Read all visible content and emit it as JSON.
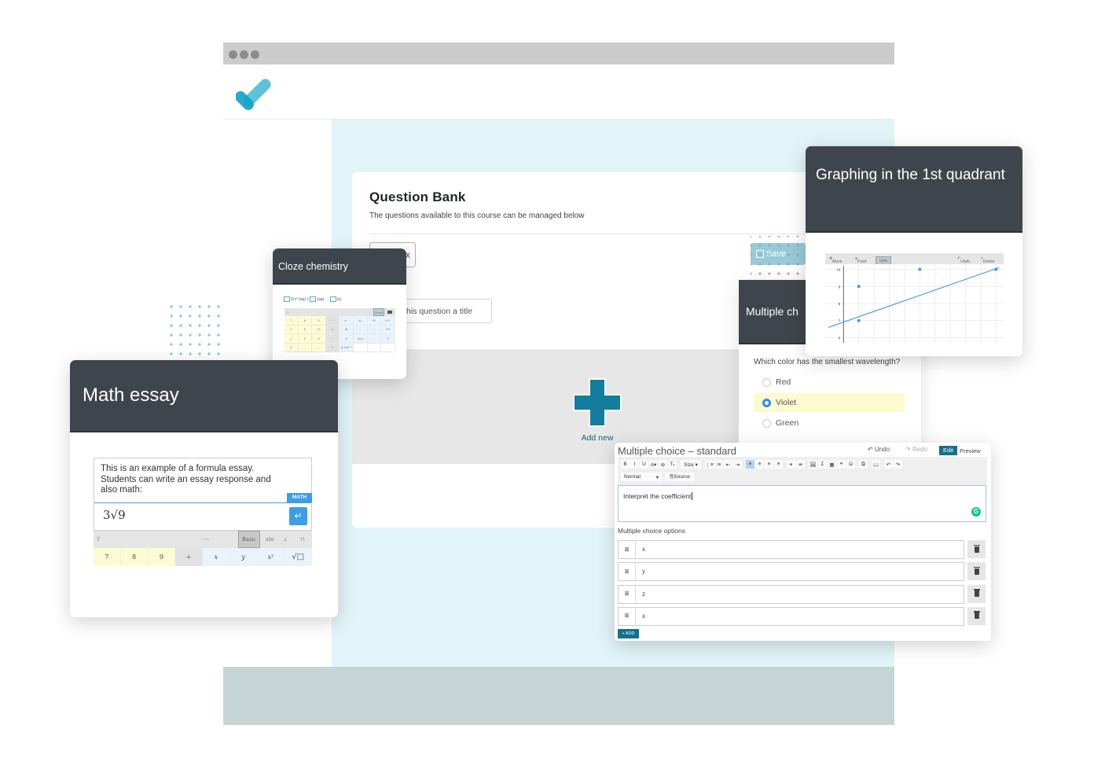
{
  "app": {
    "logo": "checkmark-logo",
    "window_dots": 3
  },
  "question_bank": {
    "title": "Question Bank",
    "subtitle": "The questions available to this course can be managed below",
    "partial_button_label": "x",
    "title_input_placeholder": "his question a title",
    "add_new_label": "Add new",
    "save_label": "Save"
  },
  "cloze_card": {
    "title": "Cloze chemistry",
    "equation": [
      "Zn²⁺(aq) +",
      "(aq) →",
      "(s)"
    ],
    "keypad_top_left": "?",
    "keypad_mode": "Chem",
    "keys": [
      "7",
      "8",
      "9",
      "÷",
      "e⁻",
      "Xₙ",
      "ᵃX",
      "Xₙᵐ",
      "4",
      "5",
      "6",
      "×",
      "⇌",
      "←",
      "→",
      "⟷",
      "1",
      "2",
      "3",
      "−",
      "½",
      "mol",
      "·",
      "δ",
      "0",
      ".",
      ",",
      "+",
      "g mol⁻¹",
      "",
      "",
      ""
    ]
  },
  "math_essay": {
    "title": "Math essay",
    "essay_text": "This is an example of a formula essay. Students can write an essay response and also math:",
    "math_tag": "MATH",
    "math_value": "3√9",
    "enter_icon": "↵",
    "keypad_top": {
      "help": "?",
      "handle": "····",
      "mode": "Basic",
      "sin": "sin",
      "angle": "∠",
      "cap": "∩"
    },
    "keys": [
      "7",
      "8",
      "9",
      "÷",
      "x",
      "y",
      "x²",
      "√□"
    ]
  },
  "multiple_choice": {
    "title": "Multiple ch",
    "question": "Which color has the smallest wavelength?",
    "options": [
      {
        "label": "Red",
        "selected": false
      },
      {
        "label": "Violet",
        "selected": true
      },
      {
        "label": "Green",
        "selected": false
      }
    ]
  },
  "graph_card": {
    "title": "Graphing in the 1st quadrant",
    "toolbar": {
      "move": "Move",
      "point": "Point",
      "line": "Line",
      "undo": "Undo",
      "delete": "Delete"
    },
    "y_ticks": [
      "10",
      "9",
      "8",
      "7",
      "6"
    ],
    "points": [
      [
        1,
        9
      ],
      [
        1,
        7
      ],
      [
        5,
        10
      ],
      [
        10,
        10
      ]
    ],
    "line": {
      "from": [
        -1,
        6.6
      ],
      "to": [
        10.2,
        10.1
      ]
    },
    "accent": "#3c9de8"
  },
  "editor": {
    "title": "Multiple choice – standard",
    "undo": "Undo",
    "redo": "Redo",
    "edit_tab": "Edit",
    "preview_tab": "Preview",
    "toolbar_row1": [
      "B",
      "I",
      "U",
      "A▾",
      "⊚",
      "Tₓ",
      "Size ▾",
      "⋮≡",
      "⁝≡",
      "⇤",
      "⇥",
      "≡",
      "≡",
      "≡",
      "≡",
      "⚭",
      "⚮",
      "🖼",
      "Σ",
      "▦",
      "❞",
      "Ω",
      "⧉",
      "📖",
      "↶",
      "↷"
    ],
    "format_select": "Normal",
    "source_btn": "Source",
    "content": "Interpret the coefficient",
    "options_label": "Multiple choice options",
    "options": [
      "x",
      "y",
      "z",
      "x"
    ],
    "add_label": "+ ADD"
  }
}
